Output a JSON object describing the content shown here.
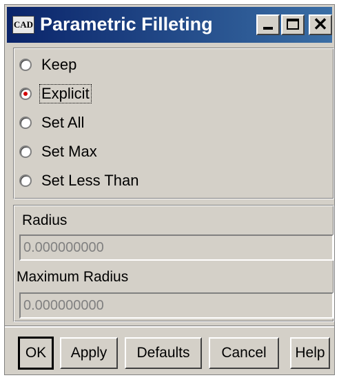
{
  "window": {
    "title": "Parametric Filleting",
    "icon_text": "CAD",
    "icon": "cad-app-icon"
  },
  "fillet_modes": [
    {
      "label": "Keep",
      "checked": false
    },
    {
      "label": "Explicit",
      "checked": true
    },
    {
      "label": "Set All",
      "checked": false
    },
    {
      "label": "Set Max",
      "checked": false
    },
    {
      "label": "Set Less Than",
      "checked": false
    }
  ],
  "radius": {
    "label": "Radius",
    "value": "0.000000000"
  },
  "max_radius": {
    "label": "Maximum Radius",
    "value": "0.000000000"
  },
  "buttons": {
    "ok": "OK",
    "apply": "Apply",
    "defaults": "Defaults",
    "cancel": "Cancel",
    "help": "Help"
  },
  "colors": {
    "titlebar_start": "#0a246a",
    "titlebar_end": "#3a6ea5",
    "radio_dot": "#d40000",
    "face": "#d4d0c8"
  }
}
